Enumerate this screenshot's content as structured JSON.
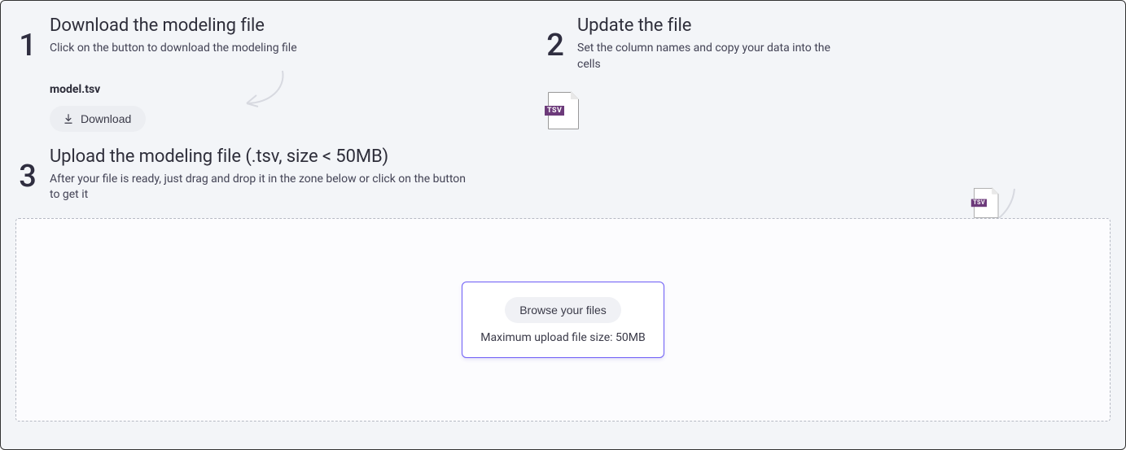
{
  "step1": {
    "number": "1",
    "title": "Download the modeling file",
    "desc": "Click on the button to download the modeling file",
    "filename": "model.tsv",
    "download_label": "Download"
  },
  "step2": {
    "number": "2",
    "title": "Update the file",
    "desc": "Set the column names and copy your data into the cells",
    "file_badge": "TSV"
  },
  "step3": {
    "number": "3",
    "title": "Upload the modeling file (.tsv, size < 50MB)",
    "desc": "After your file is ready, just drag and drop it in the zone below or click on the button to get it",
    "file_badge": "TSV"
  },
  "dropzone": {
    "browse_label": "Browse your files",
    "max_text": "Maximum upload file size: 50MB"
  }
}
